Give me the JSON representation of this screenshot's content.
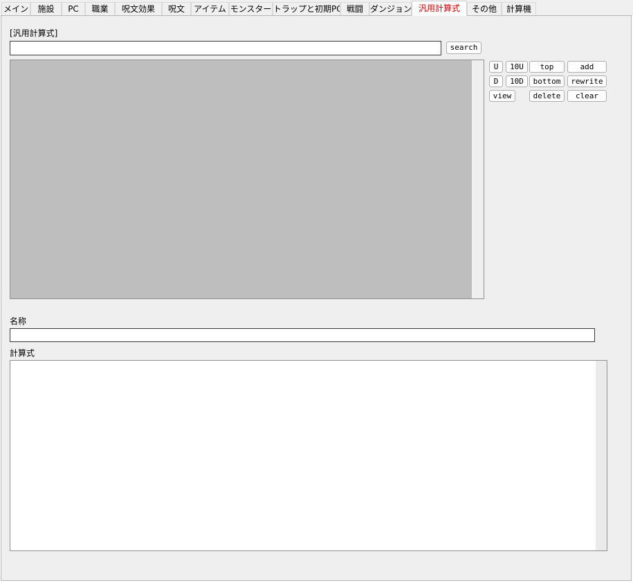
{
  "tabs": [
    "メイン",
    "施設",
    "PC",
    "職業",
    "呪文効果",
    "呪文",
    "アイテム",
    "モンスター",
    "トラップと初期PC",
    "戦闘",
    "ダンジョン",
    "汎用計算式",
    "その他",
    "計算機"
  ],
  "active_tab_index": 11,
  "section_label": "[汎用計算式]",
  "search": {
    "value": "",
    "button_label": "search"
  },
  "list_buttons": {
    "u": "U",
    "u10": "10U",
    "top": "top",
    "add": "add",
    "d": "D",
    "d10": "10D",
    "bottom": "bottom",
    "rewrite": "rewrite",
    "view": "view",
    "delete": "delete",
    "clear": "clear"
  },
  "name_field": {
    "label": "名称",
    "value": ""
  },
  "formula_field": {
    "label": "計算式",
    "value": ""
  },
  "colors": {
    "active_tab_text": "#d40000",
    "list_background": "#bebebe",
    "panel_background": "#efefef"
  }
}
